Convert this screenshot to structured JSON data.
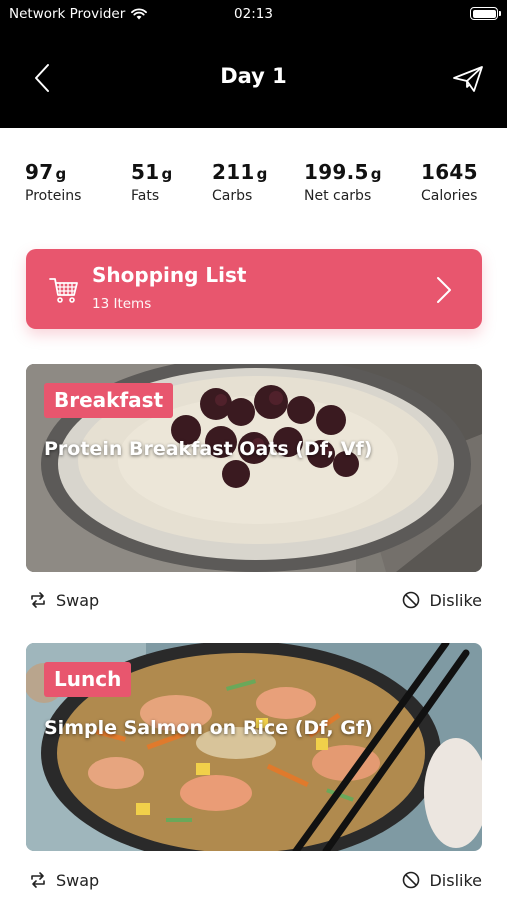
{
  "status_bar": {
    "carrier": "Network Provider",
    "time": "02:13"
  },
  "header": {
    "title": "Day 1"
  },
  "macros": [
    {
      "value": "97",
      "unit": "g",
      "label": "Proteins"
    },
    {
      "value": "51",
      "unit": "g",
      "label": "Fats"
    },
    {
      "value": "211",
      "unit": "g",
      "label": "Carbs"
    },
    {
      "value": "199.5",
      "unit": "g",
      "label": "Net carbs"
    },
    {
      "value": "1645",
      "unit": "",
      "label": "Calories"
    }
  ],
  "shopping_list": {
    "title": "Shopping List",
    "subtitle": "13 Items"
  },
  "meals": [
    {
      "tag": "Breakfast",
      "title": "Protein Breakfast Oats (Df, Vf)",
      "swap_label": "Swap",
      "dislike_label": "Dislike"
    },
    {
      "tag": "Lunch",
      "title": "Simple Salmon on Rice (Df, Gf)",
      "swap_label": "Swap",
      "dislike_label": "Dislike"
    }
  ],
  "colors": {
    "accent": "#e8566e",
    "header_bg": "#000000"
  }
}
